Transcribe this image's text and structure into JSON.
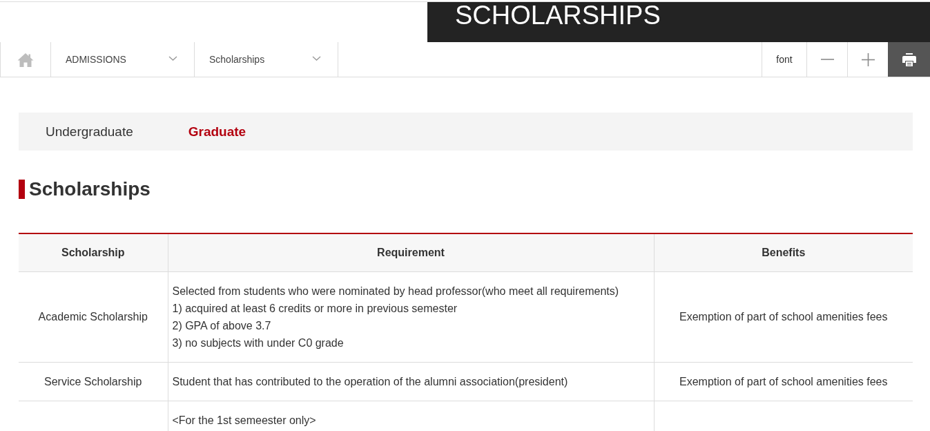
{
  "banner": {
    "title": "SCHOLARSHIPS"
  },
  "breadcrumb": {
    "items": [
      {
        "label": "ADMISSIONS"
      },
      {
        "label": "Scholarships"
      }
    ]
  },
  "font_controls": {
    "label": "font"
  },
  "tabs": [
    {
      "label": "Undergraduate",
      "selected": false
    },
    {
      "label": "Graduate",
      "selected": true
    }
  ],
  "section": {
    "heading": "Scholarships"
  },
  "table": {
    "columns": [
      "Scholarship",
      "Requirement",
      "Benefits"
    ],
    "rows": [
      {
        "scholarship": "Academic Scholarship",
        "requirement": [
          "Selected from students who were nominated by head professor(who meet all requirements)",
          "1) acquired at least 6 credits or more in previous semester",
          "2) GPA of above 3.7",
          "3) no subjects with under C0 grade"
        ],
        "benefits": "Exemption of part of school amenities fees"
      },
      {
        "scholarship": "Service Scholarship",
        "requirement": [
          "Student that has contributed to the operation of the alumni association(president)"
        ],
        "benefits": "Exemption of part of school amenities fees"
      },
      {
        "requirement": [
          "<For the 1st semeester only>"
        ]
      }
    ]
  }
}
